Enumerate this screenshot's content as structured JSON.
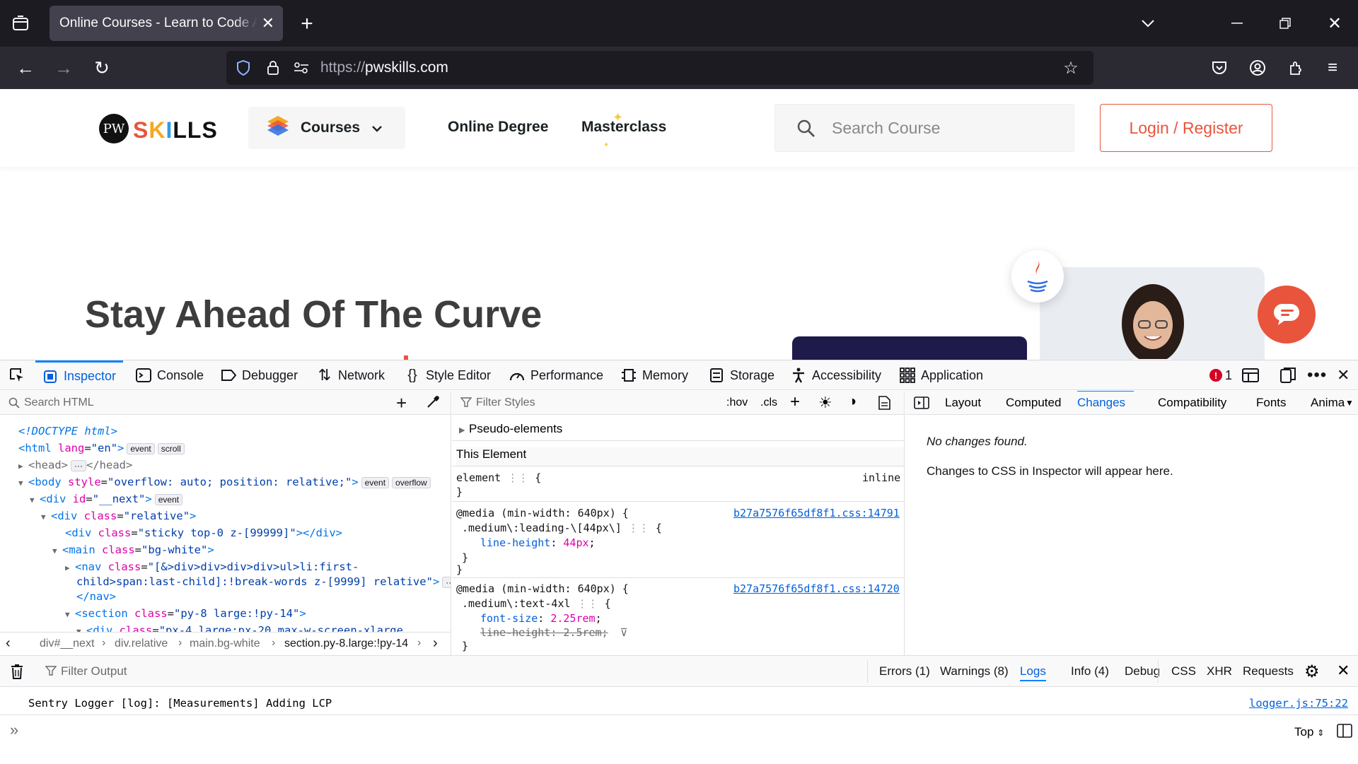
{
  "browser": {
    "tab_title": "Online Courses - Learn to Code Anywhere",
    "url_proto": "https://",
    "url_host": "pwskills.com"
  },
  "site": {
    "logo_initials": "PW",
    "logo_text": "SKILLS",
    "courses_label": "Courses",
    "online_degree": "Online Degree",
    "masterclass": "Masterclass",
    "search_placeholder": "Search Course",
    "login_label": "Login / Register",
    "hero_title": "Stay Ahead Of The Curve",
    "accent": "#e8553c"
  },
  "devtools": {
    "tabs": [
      {
        "label": "Inspector",
        "icon": "inspector-icon"
      },
      {
        "label": "Console",
        "icon": "console-icon"
      },
      {
        "label": "Debugger",
        "icon": "debugger-icon"
      },
      {
        "label": "Network",
        "icon": "network-icon"
      },
      {
        "label": "Style Editor",
        "icon": "style-editor-icon"
      },
      {
        "label": "Performance",
        "icon": "performance-icon"
      },
      {
        "label": "Memory",
        "icon": "memory-icon"
      },
      {
        "label": "Storage",
        "icon": "storage-icon"
      },
      {
        "label": "Accessibility",
        "icon": "accessibility-icon"
      },
      {
        "label": "Application",
        "icon": "application-icon"
      }
    ],
    "error_count": "1",
    "search_html_placeholder": "Search HTML",
    "filter_styles_placeholder": "Filter Styles",
    "hov": ":hov",
    "cls": ".cls",
    "tree": {
      "doctype": "<!DOCTYPE html>",
      "html_lang": "en",
      "body_style": "overflow: auto; position: relative;",
      "next_id": "__next",
      "relative_class": "relative",
      "sticky_class": "sticky top-0 z-[99999]",
      "main_class": "bg-white",
      "nav_class_1": "[&>div>div>div>div>ul>li:first-",
      "nav_class_2": "child>span:last-child]:!break-words z-[9999] relative",
      "section_class": "py-8 large:!py-14",
      "div_class": "px-4 large:px-20 max-w-screen-xlarge",
      "badge_event": "event",
      "badge_scroll": "scroll",
      "badge_overflow": "overflow",
      "badge_more": "···"
    },
    "breadcrumbs": [
      "div#__next",
      "div.relative",
      "main.bg-white",
      "section.py-8.large:!py-14"
    ],
    "styles": {
      "pseudo_elements": "Pseudo-elements",
      "this_element": "This Element",
      "element_label": "element",
      "inline_label": "inline",
      "media1": "@media (min-width: 640px) {",
      "sel1": ".medium\\:leading-\\[44px\\]",
      "file1": "b27a7576f65df8f1.css:14791",
      "prop1": "line-height",
      "val1": "44px",
      "media2": "@media (min-width: 640px) {",
      "sel2": ".medium\\:text-4xl",
      "file2": "b27a7576f65df8f1.css:14720",
      "prop2": "font-size",
      "val2": "2.25rem",
      "prop3": "line-height",
      "val3": "2.5rem"
    },
    "side_tabs": [
      "Layout",
      "Computed",
      "Changes",
      "Compatibility",
      "Fonts",
      "Anima"
    ],
    "changes_empty": "No changes found.",
    "changes_hint": "Changes to CSS in Inspector will appear here.",
    "console": {
      "filter_placeholder": "Filter Output",
      "filters": [
        "Errors (1)",
        "Warnings (8)",
        "Logs",
        "Info (4)",
        "Debug"
      ],
      "req_filters": [
        "CSS",
        "XHR",
        "Requests"
      ],
      "message": "Sentry Logger [log]: [Measurements] Adding LCP",
      "source": "logger.js:75:22",
      "context": "Top"
    }
  }
}
